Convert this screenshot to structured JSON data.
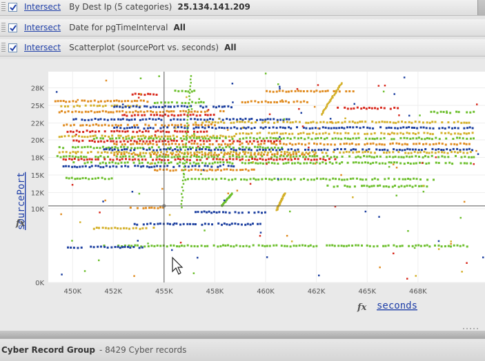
{
  "filters": [
    {
      "link": "Intersect",
      "description": "By Dest Ip (5 categories)",
      "value": "25.134.141.209",
      "checked": true
    },
    {
      "link": "Intersect",
      "description": "Date for pgTimeInterval",
      "value": "All",
      "checked": true
    },
    {
      "link": "Intersect",
      "description": "Scatterplot (sourcePort vs. seconds)",
      "value": "All",
      "checked": true
    }
  ],
  "colors": {
    "link": "#1f3fa8",
    "series": [
      "#e08a1e",
      "#d4b02a",
      "#1c3fa0",
      "#d8281c",
      "#6cbf2c"
    ]
  },
  "chart_data": {
    "type": "scatter",
    "xlabel": "seconds",
    "ylabel": "sourcePort",
    "x_ticks": [
      "450K",
      "452K",
      "455K",
      "458K",
      "460K",
      "462K",
      "465K",
      "468K"
    ],
    "x_tick_values": [
      450000,
      452000,
      454500,
      457000,
      459500,
      462000,
      464500,
      467000
    ],
    "y_ticks": [
      "0K",
      "10K",
      "12K",
      "15K",
      "18K",
      "20K",
      "22K",
      "25K",
      "28K"
    ],
    "y_tick_values": [
      0,
      10500,
      12800,
      15300,
      17800,
      20300,
      22700,
      25200,
      27700
    ],
    "xlim": [
      448800,
      470300
    ],
    "ylim": [
      0,
      30000
    ],
    "crosshair": {
      "x": 454500,
      "y": 10900
    },
    "bands": [
      {
        "y": 27200,
        "x0": 459500,
        "x1": 463800,
        "color": 0
      },
      {
        "y": 27200,
        "x0": 455000,
        "x1": 456000,
        "color": 4
      },
      {
        "y": 26800,
        "x0": 452900,
        "x1": 454100,
        "color": 3
      },
      {
        "y": 25800,
        "x0": 449100,
        "x1": 453800,
        "color": 0
      },
      {
        "y": 25700,
        "x0": 458300,
        "x1": 461600,
        "color": 0
      },
      {
        "y": 25600,
        "x0": 453800,
        "x1": 456400,
        "color": 4
      },
      {
        "y": 25100,
        "x0": 449200,
        "x1": 453400,
        "color": 1
      },
      {
        "y": 25000,
        "x0": 452000,
        "x1": 457800,
        "color": 2
      },
      {
        "y": 24800,
        "x0": 463000,
        "x1": 466000,
        "color": 3
      },
      {
        "y": 24300,
        "x0": 449300,
        "x1": 457500,
        "color": 0
      },
      {
        "y": 24200,
        "x0": 467600,
        "x1": 469700,
        "color": 4
      },
      {
        "y": 23800,
        "x0": 452500,
        "x1": 457000,
        "color": 3
      },
      {
        "y": 23200,
        "x0": 450000,
        "x1": 460700,
        "color": 2
      },
      {
        "y": 22800,
        "x0": 456000,
        "x1": 469700,
        "color": 1
      },
      {
        "y": 22400,
        "x0": 449400,
        "x1": 457000,
        "color": 0
      },
      {
        "y": 22000,
        "x0": 452000,
        "x1": 469700,
        "color": 2
      },
      {
        "y": 21500,
        "x0": 449700,
        "x1": 456700,
        "color": 3
      },
      {
        "y": 21200,
        "x0": 458000,
        "x1": 469700,
        "color": 1
      },
      {
        "y": 20800,
        "x0": 449300,
        "x1": 458000,
        "color": 1
      },
      {
        "y": 20500,
        "x0": 451000,
        "x1": 469700,
        "color": 4
      },
      {
        "y": 20100,
        "x0": 450000,
        "x1": 460300,
        "color": 3
      },
      {
        "y": 19700,
        "x0": 452000,
        "x1": 469500,
        "color": 0
      },
      {
        "y": 19200,
        "x0": 449300,
        "x1": 460300,
        "color": 4
      },
      {
        "y": 18900,
        "x0": 451500,
        "x1": 469700,
        "color": 2
      },
      {
        "y": 18500,
        "x0": 449300,
        "x1": 469700,
        "color": 1
      },
      {
        "y": 18200,
        "x0": 452000,
        "x1": 462000,
        "color": 0
      },
      {
        "y": 17900,
        "x0": 449200,
        "x1": 469700,
        "color": 4
      },
      {
        "y": 17500,
        "x0": 449500,
        "x1": 463000,
        "color": 3
      },
      {
        "y": 17000,
        "x0": 450000,
        "x1": 469700,
        "color": 4
      },
      {
        "y": 16500,
        "x0": 449500,
        "x1": 458000,
        "color": 2
      },
      {
        "y": 16000,
        "x0": 454000,
        "x1": 459000,
        "color": 0
      },
      {
        "y": 14800,
        "x0": 449500,
        "x1": 452000,
        "color": 4
      },
      {
        "y": 14700,
        "x0": 455500,
        "x1": 468000,
        "color": 4
      },
      {
        "y": 13700,
        "x0": 462500,
        "x1": 467500,
        "color": 4
      },
      {
        "y": 10600,
        "x0": 452800,
        "x1": 454500,
        "color": 0
      },
      {
        "y": 10000,
        "x0": 456000,
        "x1": 459800,
        "color": 2
      },
      {
        "y": 8300,
        "x0": 453000,
        "x1": 459300,
        "color": 2
      },
      {
        "y": 7700,
        "x0": 451000,
        "x1": 454000,
        "color": 1
      },
      {
        "y": 5200,
        "x0": 451500,
        "x1": 469700,
        "color": 4
      },
      {
        "y": 5000,
        "x0": 449600,
        "x1": 453500,
        "color": 2
      }
    ],
    "streaks": [
      {
        "x0": 455300,
        "y0": 10800,
        "x1": 455800,
        "y1": 29500,
        "color": 4
      },
      {
        "x0": 462200,
        "y0": 24000,
        "x1": 463200,
        "y1": 28500,
        "color": 1
      },
      {
        "x0": 460000,
        "y0": 10400,
        "x1": 460400,
        "y1": 12800,
        "color": 1
      },
      {
        "x0": 457300,
        "y0": 11000,
        "x1": 457800,
        "y1": 12800,
        "color": 4
      }
    ]
  },
  "status": {
    "title": "Cyber Record Group",
    "count_text": "- 8429 Cyber records"
  }
}
